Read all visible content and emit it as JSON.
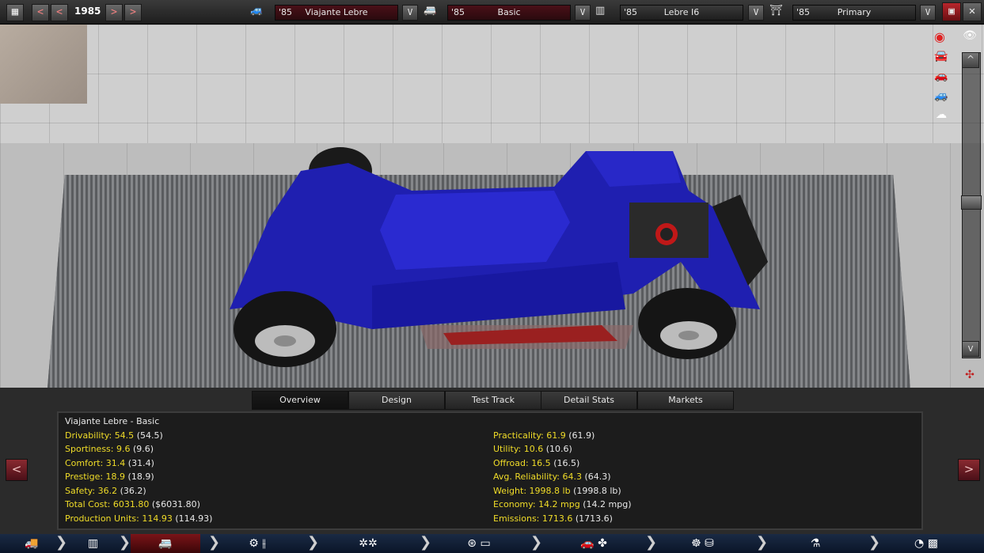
{
  "topbar": {
    "prev_fast": "<",
    "prev": "<",
    "year": "1985",
    "next": ">",
    "next_fast": ">",
    "selectors": [
      {
        "year": "'85",
        "name": "Viajante Lebre",
        "dropdown": "V"
      },
      {
        "year": "'85",
        "name": "Basic",
        "dropdown": "V"
      },
      {
        "year": "'85",
        "name": "Lebre I6",
        "dropdown": "V"
      },
      {
        "year": "'85",
        "name": "Primary",
        "dropdown": "V"
      }
    ]
  },
  "viewport": {
    "scroll_up": "^",
    "scroll_down": "v"
  },
  "tabs": [
    "Overview",
    "Design",
    "Test Track",
    "Detail Stats",
    "Markets"
  ],
  "active_tab": "Overview",
  "overview": {
    "title": "Viajante Lebre - Basic",
    "left": [
      {
        "label": "Drivability:",
        "value": "54.5",
        "sub": "(54.5)"
      },
      {
        "label": "Sportiness:",
        "value": "9.6",
        "sub": "(9.6)"
      },
      {
        "label": "Comfort:",
        "value": "31.4",
        "sub": "(31.4)"
      },
      {
        "label": "Prestige:",
        "value": "18.9",
        "sub": "(18.9)"
      },
      {
        "label": "Safety:",
        "value": "36.2",
        "sub": "(36.2)"
      },
      {
        "label": "Total Cost:",
        "value": "6031.80",
        "sub": "($6031.80)"
      },
      {
        "label": "Production Units:",
        "value": "114.93",
        "sub": "(114.93)"
      }
    ],
    "right": [
      {
        "label": "Practicality:",
        "value": "61.9",
        "sub": "(61.9)"
      },
      {
        "label": "Utility:",
        "value": "10.6",
        "sub": "(10.6)"
      },
      {
        "label": "Offroad:",
        "value": "16.5",
        "sub": "(16.5)"
      },
      {
        "label": "Avg. Reliability:",
        "value": "64.3",
        "sub": "(64.3)"
      },
      {
        "label": "Weight:",
        "value": "1998.8 lb",
        "sub": "(1998.8 lb)"
      },
      {
        "label": "Economy:",
        "value": "14.2 mpg",
        "sub": "(14.2 mpg)"
      },
      {
        "label": "Emissions:",
        "value": "1713.6",
        "sub": "(1713.6)"
      }
    ]
  },
  "side_arrows": {
    "left": "<",
    "right": ">"
  },
  "colors": {
    "accent_red": "#7a1418",
    "stat_yellow": "#f0dc28",
    "car_blue": "#1f1fb0"
  }
}
